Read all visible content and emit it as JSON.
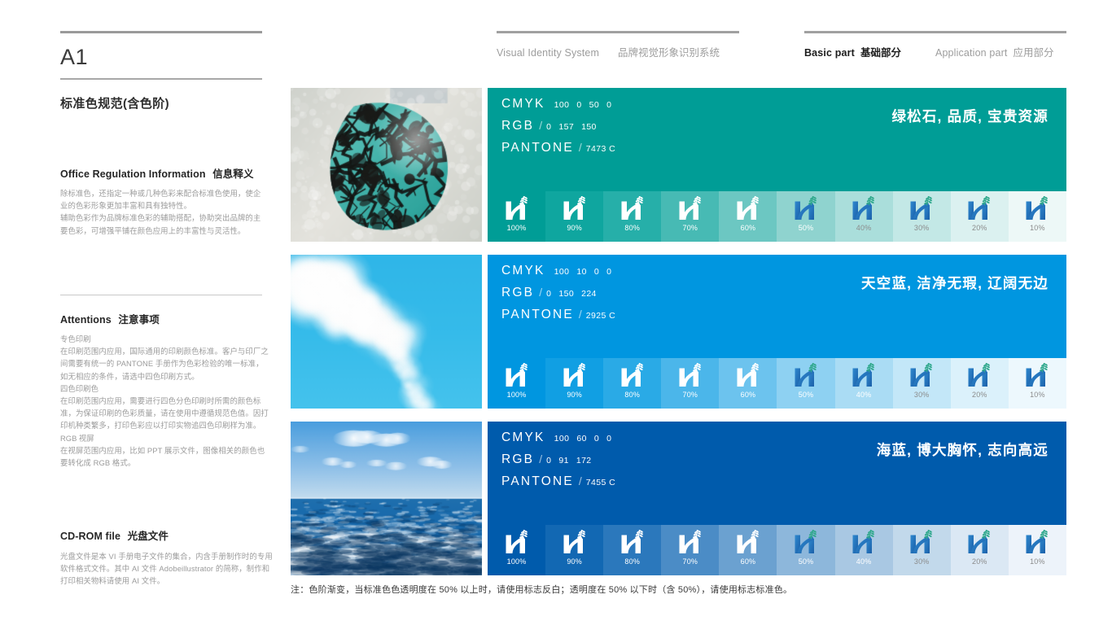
{
  "page": {
    "code": "A1",
    "subtitle": "标准色规范(含色阶)",
    "footnote": "注：色阶渐变，当标准色色透明度在 50% 以上时，请使用标志反白；透明度在 50% 以下时（含 50%），请使用标志标准色。"
  },
  "topnav": {
    "left": [
      {
        "en": "Visual Identity System",
        "cn": "品牌视觉形象识别系统",
        "active": false
      }
    ],
    "right": [
      {
        "en": "Basic part",
        "cn": "基础部分",
        "active": true
      },
      {
        "en": "Application part",
        "cn": "应用部分",
        "active": false
      }
    ]
  },
  "sidebar": {
    "office": {
      "title_en": "Office Regulation Information",
      "title_cn": "信息释义",
      "paragraphs": [
        "除标准色，还指定一种或几种色彩来配合标准色使用，使企业的色彩形象更加丰富和具有独特性。",
        "辅助色彩作为品牌标准色彩的辅助搭配，协助突出品牌的主要色彩，可增强平铺在颜色应用上的丰富性与灵活性。"
      ]
    },
    "attentions": {
      "title_en": "Attentions",
      "title_cn": "注意事项",
      "items": [
        {
          "label": "专色印刷",
          "text": "在印刷范围内应用，国际通用的印刷颜色标准。客户与印厂之间需要有统一的 PANTONE 手册作为色彩检验的唯一标准，如无相应的条件，请选中四色印刷方式。"
        },
        {
          "label": "四色印刷色",
          "text": "在印刷范围内应用，需要进行四色分色印刷时所需的颜色标准，为保证印刷的色彩质量，请在使用中遵循规范色值。因打印机种类繁多，打印色彩应以打印实物追四色印刷样为准。"
        },
        {
          "label": "RGB 视屏",
          "text": "在视屏范围内应用，比如 PPT 展示文件，图像相关的颜色也要转化成 RGB 格式。"
        }
      ]
    },
    "cdrom": {
      "title_en": "CD-ROM file",
      "title_cn": "光盘文件",
      "text": "光盘文件是本 VI 手册电子文件的集合，内含手册制作时的专用软件格式文件。其中 AI 文件 Adobeillustrator 的简称，制作和打印相关物料请使用 AI 文件。"
    }
  },
  "labels": {
    "cmyk": "CMYK",
    "rgb": "RGB",
    "pantone": "PANTONE",
    "separator": "/"
  },
  "colors": [
    {
      "id": "turquoise",
      "name_cn": "绿松石",
      "slogan": "绿松石, 品质, 宝贵资源",
      "photo": "turquoise-stone-photo",
      "cmyk": [
        "100",
        "0",
        "50",
        "0"
      ],
      "rgb": [
        "0",
        "157",
        "150"
      ],
      "pantone": "7473 C",
      "hex": "#009D96",
      "tints": [
        {
          "pct": "100%",
          "hex": "#009d96",
          "logo": "white",
          "label_color": "#ffffff"
        },
        {
          "pct": "90%",
          "hex": "#0fa69f",
          "logo": "white",
          "label_color": "#ffffff"
        },
        {
          "pct": "80%",
          "hex": "#26afa9",
          "logo": "white",
          "label_color": "#ffffff"
        },
        {
          "pct": "70%",
          "hex": "#47bab4",
          "logo": "white",
          "label_color": "#ffffff"
        },
        {
          "pct": "60%",
          "hex": "#6cc7c2",
          "logo": "white",
          "label_color": "#ffffff"
        },
        {
          "pct": "50%",
          "hex": "#8fd3cf",
          "logo": "color",
          "label_color": "#ffffff"
        },
        {
          "pct": "40%",
          "hex": "#aadedb",
          "logo": "color",
          "label_color": "#8b8b8b"
        },
        {
          "pct": "30%",
          "hex": "#c3e8e6",
          "logo": "color",
          "label_color": "#8b8b8b"
        },
        {
          "pct": "20%",
          "hex": "#dbf1f0",
          "logo": "color",
          "label_color": "#8b8b8b"
        },
        {
          "pct": "10%",
          "hex": "#edf8f7",
          "logo": "color",
          "label_color": "#8b8b8b"
        }
      ]
    },
    {
      "id": "sky-blue",
      "name_cn": "天空蓝",
      "slogan": "天空蓝, 洁净无瑕, 辽阔无边",
      "photo": "sky-clouds-photo",
      "cmyk": [
        "100",
        "10",
        "0",
        "0"
      ],
      "rgb": [
        "0",
        "150",
        "224"
      ],
      "pantone": "2925 C",
      "hex": "#0096E0",
      "tints": [
        {
          "pct": "100%",
          "hex": "#0096e0",
          "logo": "white",
          "label_color": "#ffffff"
        },
        {
          "pct": "90%",
          "hex": "#119fe3",
          "logo": "white",
          "label_color": "#ffffff"
        },
        {
          "pct": "80%",
          "hex": "#2aaae6",
          "logo": "white",
          "label_color": "#ffffff"
        },
        {
          "pct": "70%",
          "hex": "#4bb6ea",
          "logo": "white",
          "label_color": "#ffffff"
        },
        {
          "pct": "60%",
          "hex": "#6cc3ee",
          "logo": "white",
          "label_color": "#ffffff"
        },
        {
          "pct": "50%",
          "hex": "#8ed1f2",
          "logo": "color",
          "label_color": "#ffffff"
        },
        {
          "pct": "40%",
          "hex": "#aadcf4",
          "logo": "color",
          "label_color": "#ffffff"
        },
        {
          "pct": "30%",
          "hex": "#c3e7f8",
          "logo": "color",
          "label_color": "#8b8b8b"
        },
        {
          "pct": "20%",
          "hex": "#dbf1fb",
          "logo": "color",
          "label_color": "#8b8b8b"
        },
        {
          "pct": "10%",
          "hex": "#edf8fd",
          "logo": "color",
          "label_color": "#8b8b8b"
        }
      ]
    },
    {
      "id": "ocean-blue",
      "name_cn": "海蓝",
      "slogan": "海蓝, 博大胸怀, 志向高远",
      "photo": "ocean-sea-photo",
      "cmyk": [
        "100",
        "60",
        "0",
        "0"
      ],
      "rgb": [
        "0",
        "91",
        "172"
      ],
      "pantone": "7455 C",
      "hex": "#005BAC",
      "tints": [
        {
          "pct": "100%",
          "hex": "#005bac",
          "logo": "white",
          "label_color": "#ffffff"
        },
        {
          "pct": "90%",
          "hex": "#1268b3",
          "logo": "white",
          "label_color": "#ffffff"
        },
        {
          "pct": "80%",
          "hex": "#2b78bc",
          "logo": "white",
          "label_color": "#ffffff"
        },
        {
          "pct": "70%",
          "hex": "#4b8cc6",
          "logo": "white",
          "label_color": "#ffffff"
        },
        {
          "pct": "60%",
          "hex": "#6ba1d0",
          "logo": "white",
          "label_color": "#ffffff"
        },
        {
          "pct": "50%",
          "hex": "#8db7db",
          "logo": "color",
          "label_color": "#ffffff"
        },
        {
          "pct": "40%",
          "hex": "#a9c8e3",
          "logo": "color",
          "label_color": "#ffffff"
        },
        {
          "pct": "30%",
          "hex": "#c2d9eb",
          "logo": "color",
          "label_color": "#8b8b8b"
        },
        {
          "pct": "20%",
          "hex": "#dbe8f4",
          "logo": "color",
          "label_color": "#8b8b8b"
        },
        {
          "pct": "10%",
          "hex": "#edf3fa",
          "logo": "color",
          "label_color": "#8b8b8b"
        }
      ]
    }
  ],
  "logo": {
    "name": "brand-h-wheat-logo",
    "blue": "#1a5fa8",
    "blue_light": "#2f89cf",
    "green": "#2fa88c"
  }
}
